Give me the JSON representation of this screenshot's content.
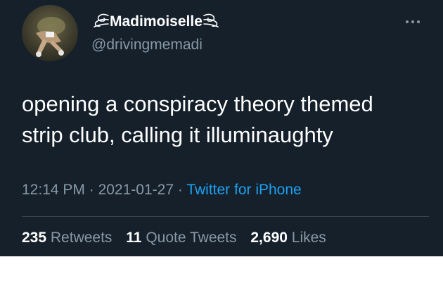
{
  "tweet": {
    "display_name": "Madimoiselle",
    "handle": "@drivingmemadi",
    "text_line1": "opening a conspiracy theory themed",
    "text_line2": "strip club, calling it illuminaughty",
    "time": "12:14 PM",
    "date": "2021-01-27",
    "source": "Twitter for iPhone",
    "separator": "·"
  },
  "stats": {
    "retweets_count": "235",
    "retweets_label": "Retweets",
    "quote_tweets_count": "11",
    "quote_tweets_label": "Quote Tweets",
    "likes_count": "2,690",
    "likes_label": "Likes"
  },
  "icons": {
    "flourish_left": "flourish-icon",
    "flourish_right": "flourish-icon",
    "more": "more-icon"
  },
  "colors": {
    "background": "#15202b",
    "secondary_text": "#8899a6",
    "link": "#1da1f2",
    "divider": "#38444d"
  }
}
